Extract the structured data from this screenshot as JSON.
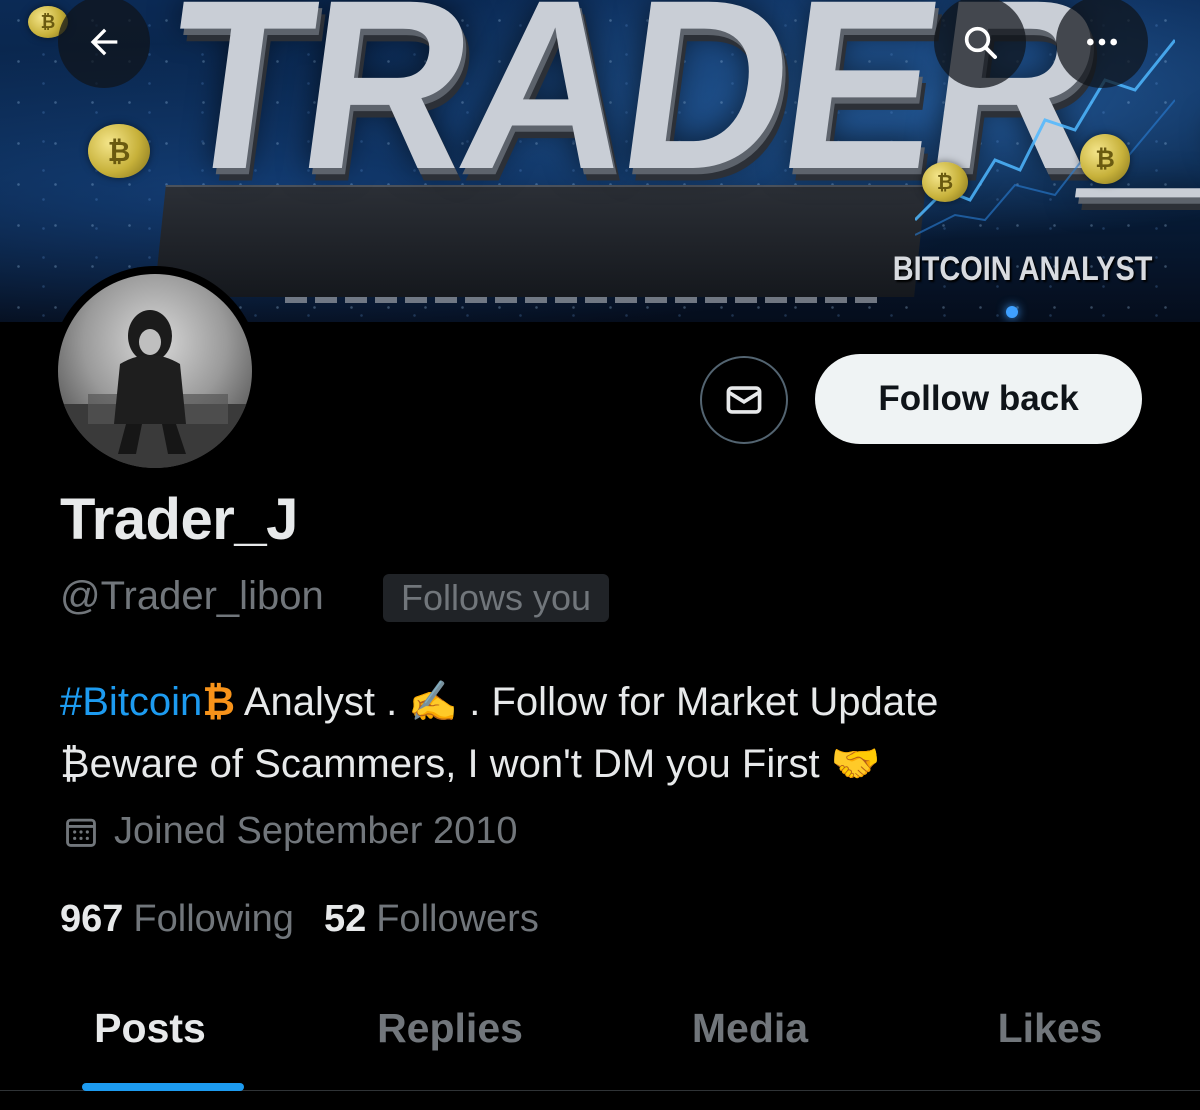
{
  "banner": {
    "title": "TRADER_J",
    "subtitle": "BITCOIN ANALYST",
    "coin_symbol": "₿"
  },
  "header": {
    "back_icon": "arrow-left-icon",
    "search_icon": "search-icon",
    "more_icon": "more-horizontal-icon"
  },
  "profile": {
    "display_name": "Trader_J",
    "handle": "@Trader_libon",
    "follows_you": "Follows you",
    "bio": {
      "hashtag": "#Bitcoin",
      "btc_symbol": "₿",
      "line1_rest": " Analyst . ",
      "writing_emoji": "✍️",
      "line1_end": " . Follow for Market Update",
      "line2": "₿eware of Scammers, I won't DM you First ",
      "handshake_emoji": "🤝"
    },
    "joined": "Joined September 2010",
    "following_count": "967",
    "following_label": "Following",
    "followers_count": "52",
    "followers_label": "Followers"
  },
  "actions": {
    "message_icon": "envelope-icon",
    "follow_label": "Follow back"
  },
  "tabs": [
    {
      "label": "Posts",
      "active": true
    },
    {
      "label": "Replies",
      "active": false
    },
    {
      "label": "Media",
      "active": false
    },
    {
      "label": "Likes",
      "active": false
    }
  ],
  "colors": {
    "accent": "#1d9bf0",
    "background": "#000000",
    "muted_text": "#71767b",
    "bitcoin_orange": "#f7931a"
  }
}
